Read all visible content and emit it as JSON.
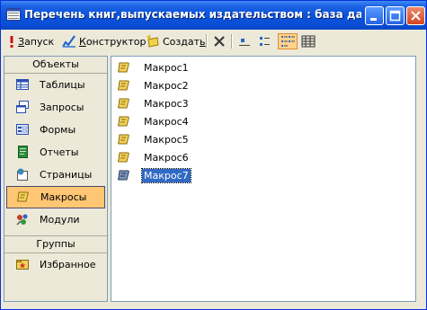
{
  "window": {
    "title": "Перечень книг,выпускаемых издательством : база данн..."
  },
  "toolbar": {
    "run_label": "Запуск",
    "design_label": "Конструктор",
    "create_label": "Создать"
  },
  "left_pane": {
    "objects_header": "Объекты",
    "items": [
      {
        "label": "Таблицы",
        "icon": "table-icon"
      },
      {
        "label": "Запросы",
        "icon": "query-icon"
      },
      {
        "label": "Формы",
        "icon": "form-icon"
      },
      {
        "label": "Отчеты",
        "icon": "report-icon"
      },
      {
        "label": "Страницы",
        "icon": "page-icon"
      },
      {
        "label": "Макросы",
        "icon": "macro-icon",
        "selected": true
      },
      {
        "label": "Модули",
        "icon": "module-icon"
      }
    ],
    "groups_header": "Группы",
    "groups": [
      {
        "label": "Избранное",
        "icon": "favorites-icon"
      }
    ]
  },
  "macros": {
    "items": [
      "Макрос1",
      "Макрос2",
      "Макрос3",
      "Макрос4",
      "Макрос5",
      "Макрос6",
      "Макрос7"
    ],
    "selected": "Макрос7"
  },
  "colors": {
    "title_bar": "#0b53dc",
    "selection": "#316ac5",
    "nav_active": "#ffc673"
  }
}
